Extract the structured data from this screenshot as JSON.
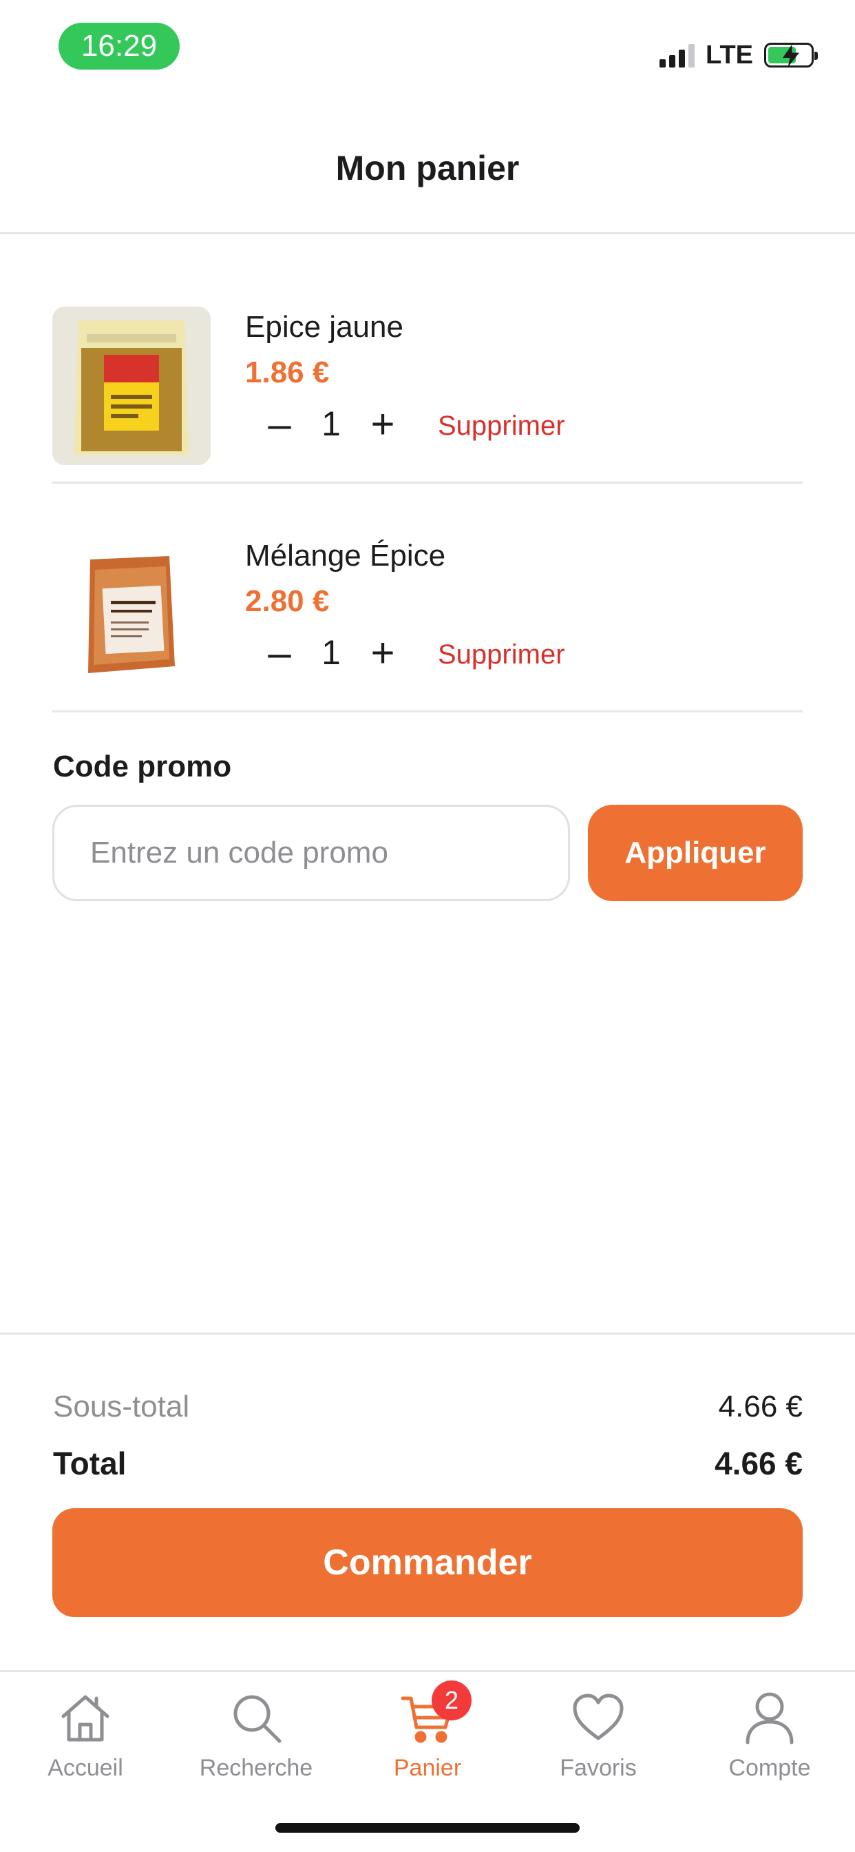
{
  "status_bar": {
    "time": "16:29",
    "network": "LTE",
    "colors": {
      "time_pill": "#34c759",
      "battery_fill": "#34c759"
    },
    "icons": [
      "signal-icon",
      "battery-charging-icon"
    ]
  },
  "header": {
    "title": "Mon panier"
  },
  "cart": {
    "items": [
      {
        "name": "Epice jaune",
        "price": "1.86 €",
        "quantity": "1",
        "remove_label": "Supprimer",
        "image_icon": "spice-bag-yellow-image"
      },
      {
        "name": "Mélange Épice",
        "price": "2.80 €",
        "quantity": "1",
        "remove_label": "Supprimer",
        "image_icon": "spice-bag-mix-image"
      }
    ],
    "decrement_symbol": "–",
    "increment_symbol": "+"
  },
  "promo": {
    "label": "Code promo",
    "placeholder": "Entrez un code promo",
    "value": "",
    "apply_label": "Appliquer"
  },
  "summary": {
    "subtotal_label": "Sous-total",
    "subtotal_value": "4.66 €",
    "total_label": "Total",
    "total_value": "4.66 €",
    "checkout_label": "Commander"
  },
  "tab_bar": {
    "tabs": [
      {
        "label": "Accueil",
        "icon": "home-icon",
        "active": false
      },
      {
        "label": "Recherche",
        "icon": "search-icon",
        "active": false
      },
      {
        "label": "Panier",
        "icon": "cart-icon",
        "active": true,
        "badge": "2"
      },
      {
        "label": "Favoris",
        "icon": "heart-icon",
        "active": false
      },
      {
        "label": "Compte",
        "icon": "user-icon",
        "active": false
      }
    ]
  },
  "colors": {
    "accent": "#ee7133",
    "danger": "#d8302b",
    "badge": "#f23a3a",
    "muted": "#8e8e93",
    "divider": "#e5e5ea"
  }
}
